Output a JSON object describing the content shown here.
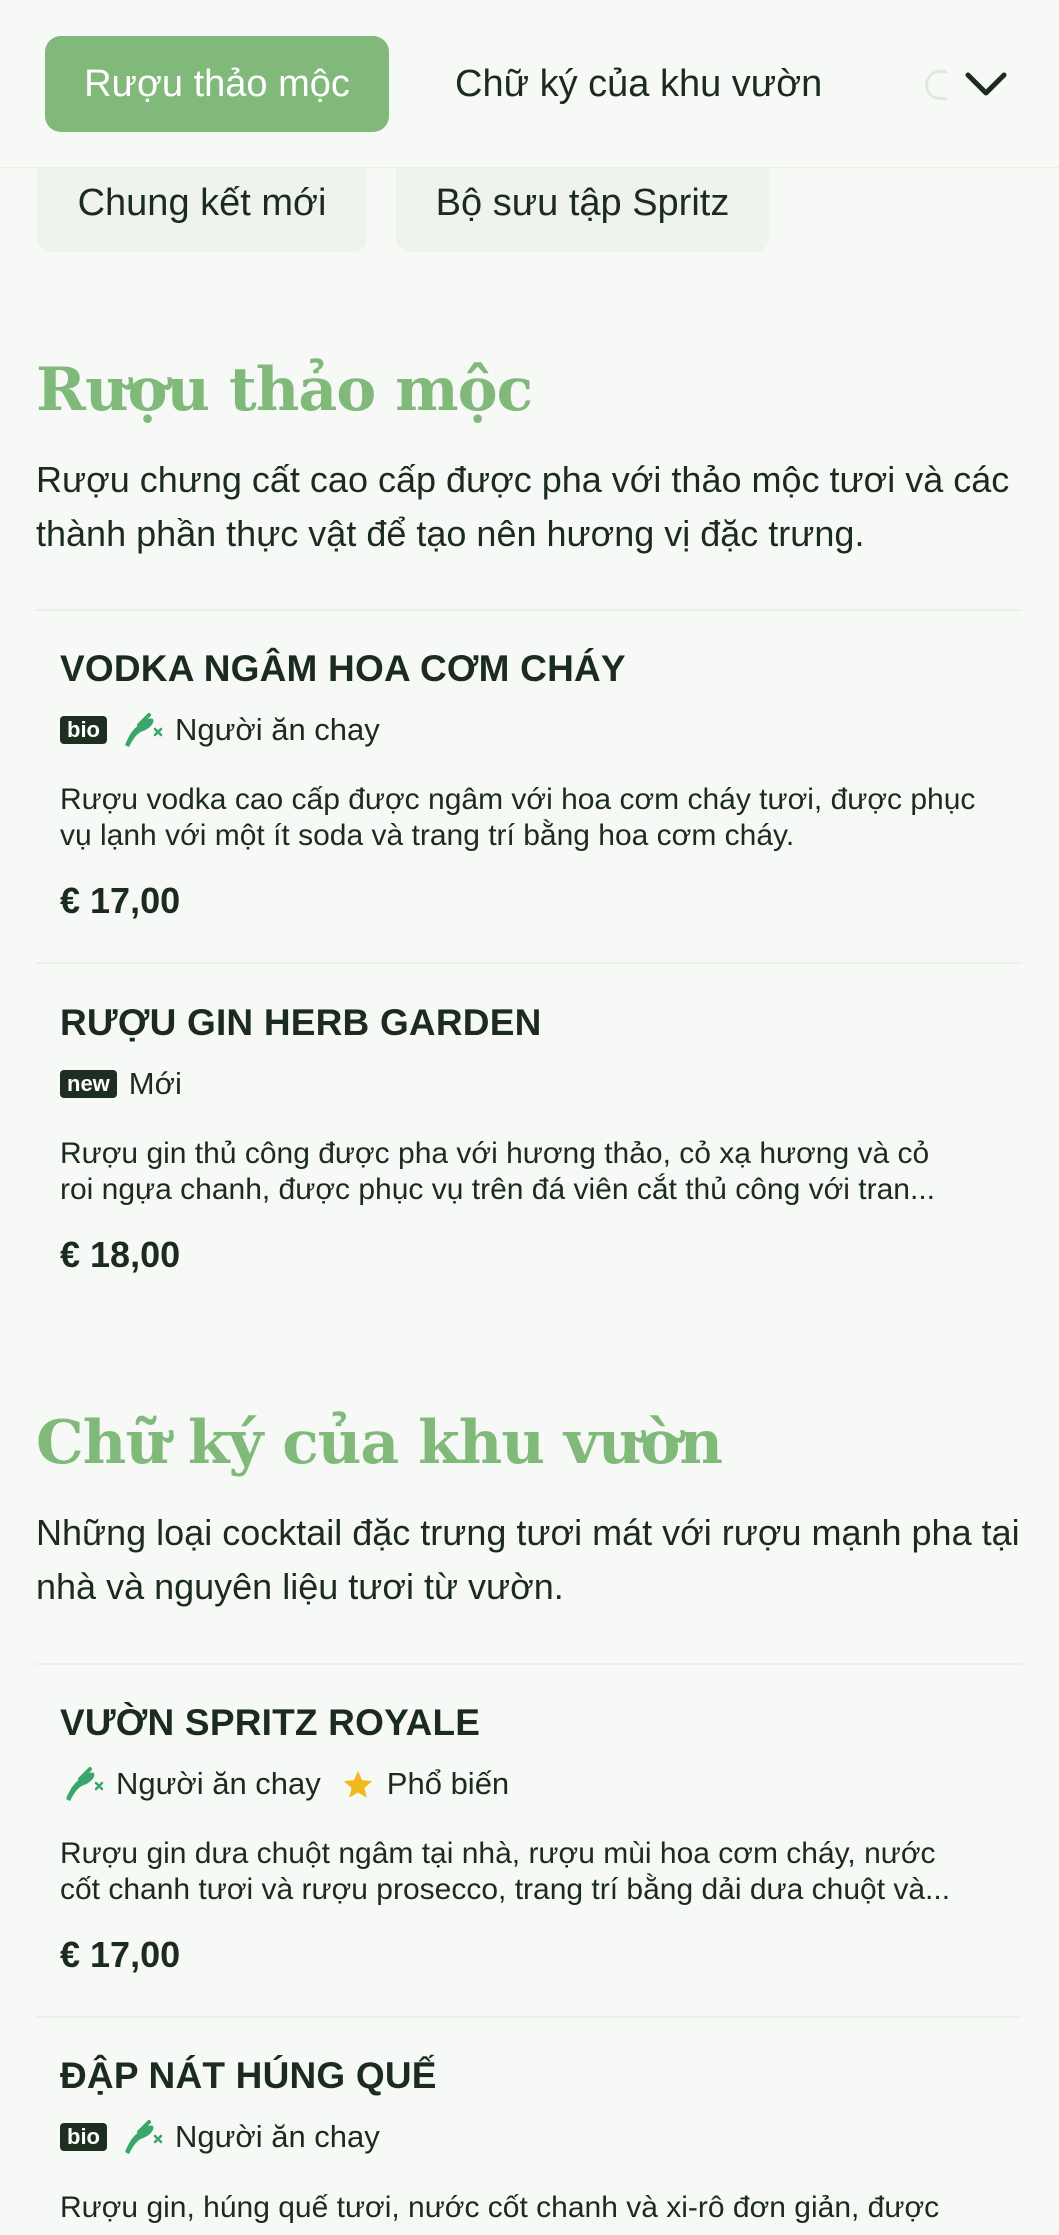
{
  "nav": {
    "tabs": [
      {
        "label": "Rượu thảo mộc",
        "active": true
      },
      {
        "label": "Chữ ký của khu vườn",
        "active": false
      }
    ],
    "chips": [
      {
        "label": "Chung kết mới"
      },
      {
        "label": "Bộ sưu tập Spritz"
      }
    ],
    "expand_icon": "chevron-down-icon"
  },
  "colors": {
    "accent": "#80b97a",
    "text": "#1c2b20",
    "background": "#f6f9f5",
    "badge": "#1e2f22",
    "vegetarian_icon": "#3aa66b",
    "popular_star": "#f2b81d"
  },
  "sections": [
    {
      "title": "Rượu thảo mộc",
      "description": "Rượu chưng cất cao cấp được pha với thảo mộc tươi và các thành phần thực vật để tạo nên hương vị đặc trưng.",
      "items": [
        {
          "name": "VODKA NGÂM HOA CƠM CHÁY",
          "badge": "bio",
          "tags": [
            "Người ăn chay"
          ],
          "description": "Rượu vodka cao cấp được ngâm với hoa cơm cháy tươi, được phục vụ lạnh với một ít soda và trang trí bằng hoa cơm cháy.",
          "price": "€ 17,00"
        },
        {
          "name": "RƯỢU GIN HERB GARDEN",
          "badge": "new",
          "tags": [
            "Mới"
          ],
          "description_line1": "Rượu gin thủ công được pha với hương thảo, cỏ xạ hương và cỏ",
          "description_line2": "roi ngựa chanh, được phục vụ trên đá viên cắt thủ công với tran...",
          "price": "€ 18,00"
        }
      ]
    },
    {
      "title": "Chữ ký của khu vườn",
      "description": "Những loại cocktail đặc trưng tươi mát với rượu mạnh pha tại nhà và nguyên liệu tươi từ vườn.",
      "items": [
        {
          "name": "VƯỜN SPRITZ ROYALE",
          "tags": [
            "Người ăn chay",
            "Phổ biến"
          ],
          "description_line1": "Rượu gin dưa chuột ngâm tại nhà, rượu mùi hoa cơm cháy, nước",
          "description_line2": "cốt chanh tươi và rượu prosecco, trang trí bằng dải dưa chuột và...",
          "price": "€ 17,00"
        },
        {
          "name": "ĐẬP NÁT HÚNG QUẾ",
          "badge": "bio",
          "tags": [
            "Người ăn chay"
          ],
          "description": "Rượu gin, húng quế tươi, nước cốt chanh và xi-rô đơn giản, được"
        }
      ]
    }
  ]
}
